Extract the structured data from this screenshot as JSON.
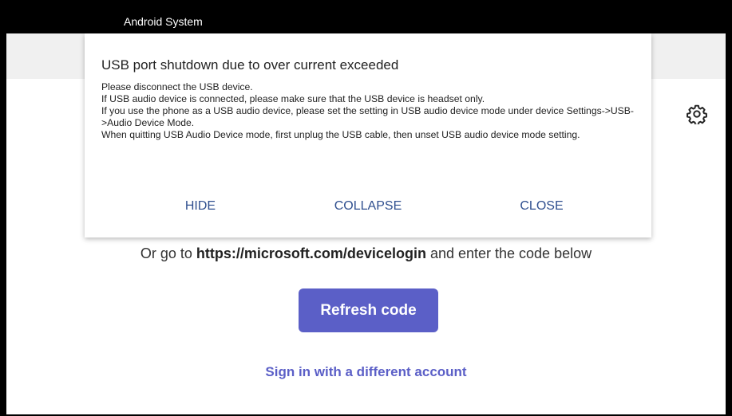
{
  "status_bar": {
    "title": "Android System"
  },
  "page": {
    "goto_prefix": "Or go to ",
    "goto_url": "https://microsoft.com/devicelogin",
    "goto_suffix": " and enter the code below",
    "refresh_label": "Refresh code",
    "signin_label": "Sign in with a different account",
    "settings_icon": "gear-icon",
    "accent_color": "#5b5fc7"
  },
  "dialog": {
    "title": "USB port shutdown due to over current exceeded",
    "lines": [
      "Please disconnect the USB device.",
      "If USB audio device is connected, please make sure that the USB device is headset only.",
      "If you use the phone as a USB audio device, please set the setting in USB audio device mode under device Settings->USB->Audio Device Mode.",
      "When quitting USB Audio Device mode, first unplug the USB cable, then unset USB audio device mode setting."
    ],
    "buttons": {
      "hide": "HIDE",
      "collapse": "COLLAPSE",
      "close": "CLOSE"
    }
  }
}
